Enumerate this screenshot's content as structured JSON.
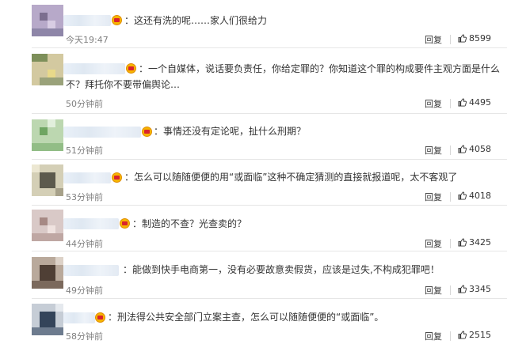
{
  "comments": [
    {
      "text": "：这还有洗的呢……家人们很给力",
      "time": "今天19:47",
      "reply": "回复",
      "likes": "8599"
    },
    {
      "text": "：一个自媒体，说话要负责任，你给定罪的？你知道这个罪的构成要件主观方面是什么",
      "text2": "不？拜托你不要带偏舆论…",
      "time": "50分钟前",
      "reply": "回复",
      "likes": "4495"
    },
    {
      "text": "：事情还没有定论呢，扯什么刑期？",
      "time": "51分钟前",
      "reply": "回复",
      "likes": "4058"
    },
    {
      "text": "：怎么可以随随便便的用“或面临”这种不确定猜测的直接就报道呢，太不客观了",
      "time": "53分钟前",
      "reply": "回复",
      "likes": "4018"
    },
    {
      "text": "：制造的不查？光查卖的？",
      "time": "44分钟前",
      "reply": "回复",
      "likes": "3425"
    },
    {
      "text": "：能做到快手电商第一，没有必要故意卖假货，应该是过失,不构成犯罪吧！",
      "time": "49分钟前",
      "reply": "回复",
      "likes": "3345"
    },
    {
      "text": "：刑法得公共安全部门立案主查，怎么可以随随便便的“或面临”。",
      "time": "58分钟前",
      "reply": "回复",
      "likes": "2515"
    }
  ],
  "colors": {
    "crown": "#f7b500",
    "thumb": "#333333"
  },
  "icons": {
    "like": "thumb-up-icon",
    "badge": "vip-crown-icon"
  }
}
